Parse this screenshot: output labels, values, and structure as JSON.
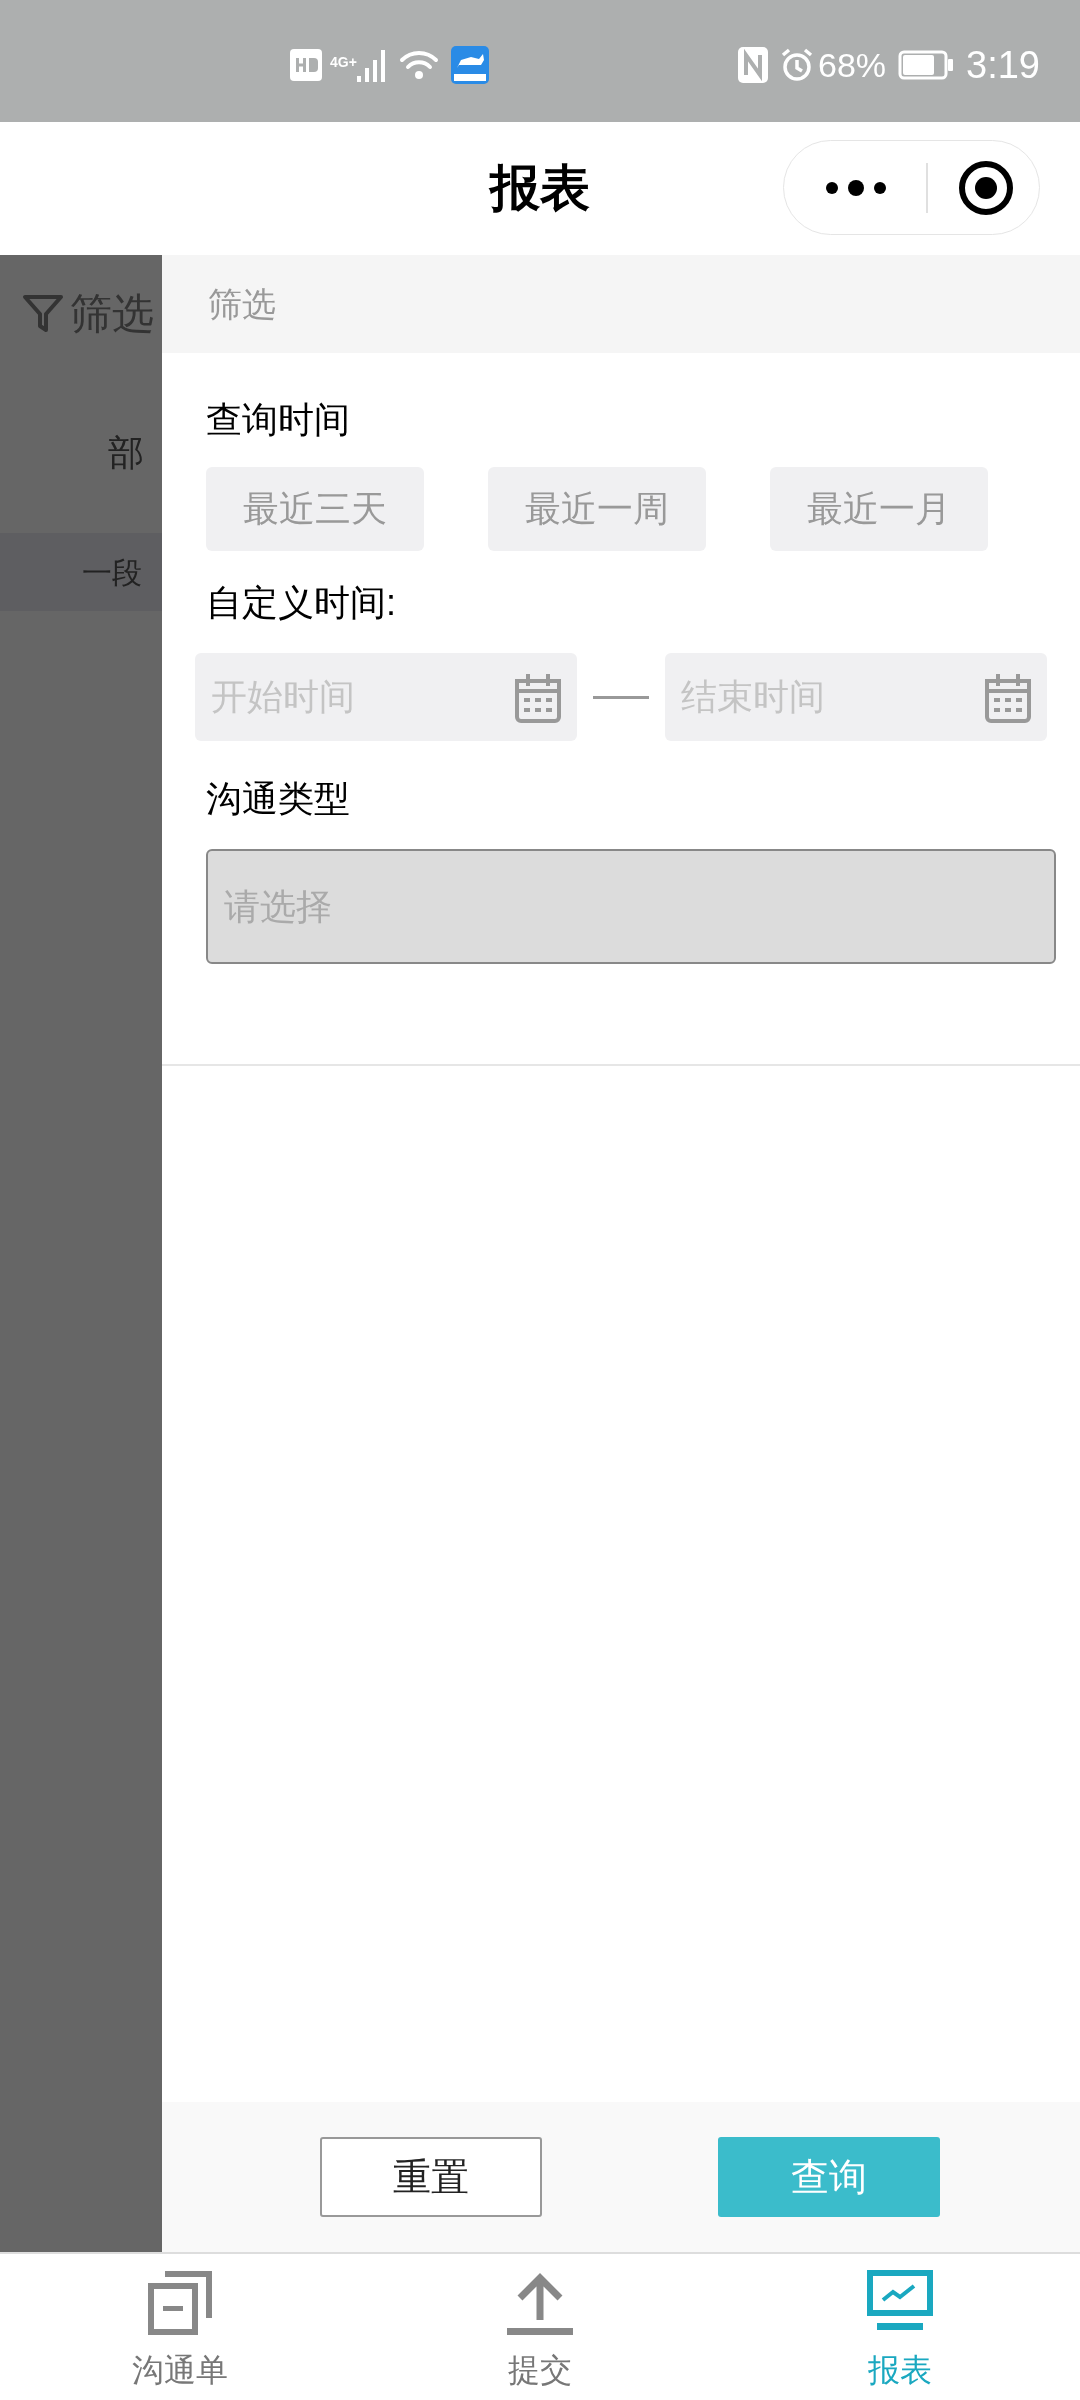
{
  "status_bar": {
    "network": "4G+",
    "battery": "68%",
    "time": "3:19"
  },
  "nav": {
    "title": "报表"
  },
  "background": {
    "filter_label": "筛选",
    "column_label": "部",
    "row_text": "一段"
  },
  "panel": {
    "header": "筛选",
    "query_time": {
      "label": "查询时间",
      "ranges": [
        {
          "label": "最近三天",
          "selected": false
        },
        {
          "label": "最近一周",
          "selected": false
        },
        {
          "label": "最近一月",
          "selected": false
        }
      ]
    },
    "custom_time": {
      "label": "自定义时间:",
      "start": {
        "placeholder": "开始时间"
      },
      "end": {
        "placeholder": "结束时间"
      }
    },
    "type": {
      "label": "沟通类型",
      "placeholder": "请选择"
    },
    "buttons": [
      {
        "kind": "secondary",
        "label": "重置"
      },
      {
        "kind": "primary",
        "label": "查询"
      }
    ]
  },
  "tabs": [
    {
      "kind": "list",
      "label": "沟通单",
      "selected": false
    },
    {
      "kind": "upload",
      "label": "提交",
      "selected": false
    },
    {
      "kind": "chart",
      "label": "报表",
      "selected": true
    }
  ]
}
